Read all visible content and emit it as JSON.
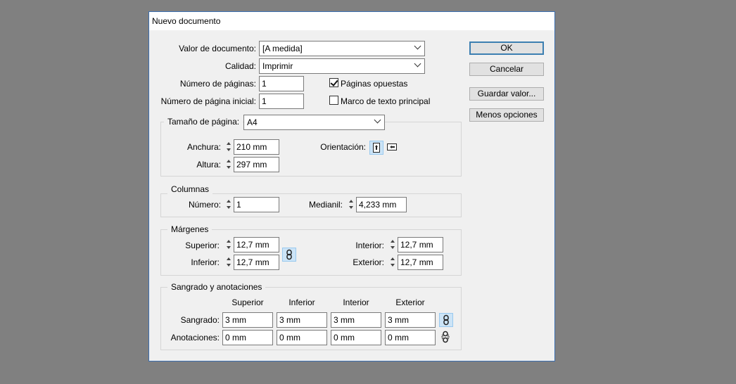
{
  "window": {
    "title": "Nuevo documento"
  },
  "preset": {
    "label": "Valor de documento:",
    "value": "[A medida]"
  },
  "intent": {
    "label": "Calidad:",
    "value": "Imprimir"
  },
  "num_pages": {
    "label": "Número de páginas:",
    "value": "1"
  },
  "start_page": {
    "label": "Número de página inicial:",
    "value": "1"
  },
  "facing_pages": {
    "label": "Páginas opuestas",
    "checked": true
  },
  "master_text_frame": {
    "label": "Marco de texto principal",
    "checked": false
  },
  "page_size": {
    "label": "Tamaño de página:",
    "value": "A4",
    "width_label": "Anchura:",
    "width": "210 mm",
    "height_label": "Altura:",
    "height": "297 mm",
    "orientation_label": "Orientación:",
    "orientation_selected": "portrait"
  },
  "columns": {
    "title": "Columnas",
    "number_label": "Número:",
    "number": "1",
    "gutter_label": "Medianil:",
    "gutter": "4,233 mm"
  },
  "margins": {
    "title": "Márgenes",
    "top_label": "Superior:",
    "top": "12,7 mm",
    "bottom_label": "Inferior:",
    "bottom": "12,7 mm",
    "inside_label": "Interior:",
    "inside": "12,7 mm",
    "outside_label": "Exterior:",
    "outside": "12,7 mm",
    "linked": true
  },
  "bleed_slug": {
    "title": "Sangrado y anotaciones",
    "headers": [
      "Superior",
      "Inferior",
      "Interior",
      "Exterior"
    ],
    "bleed_label": "Sangrado:",
    "bleed": [
      "3 mm",
      "3 mm",
      "3 mm",
      "3 mm"
    ],
    "slug_label": "Anotaciones:",
    "slug": [
      "0 mm",
      "0 mm",
      "0 mm",
      "0 mm"
    ]
  },
  "buttons": {
    "ok": "OK",
    "cancel": "Cancelar",
    "save_preset": "Guardar valor...",
    "fewer_options": "Menos opciones"
  }
}
